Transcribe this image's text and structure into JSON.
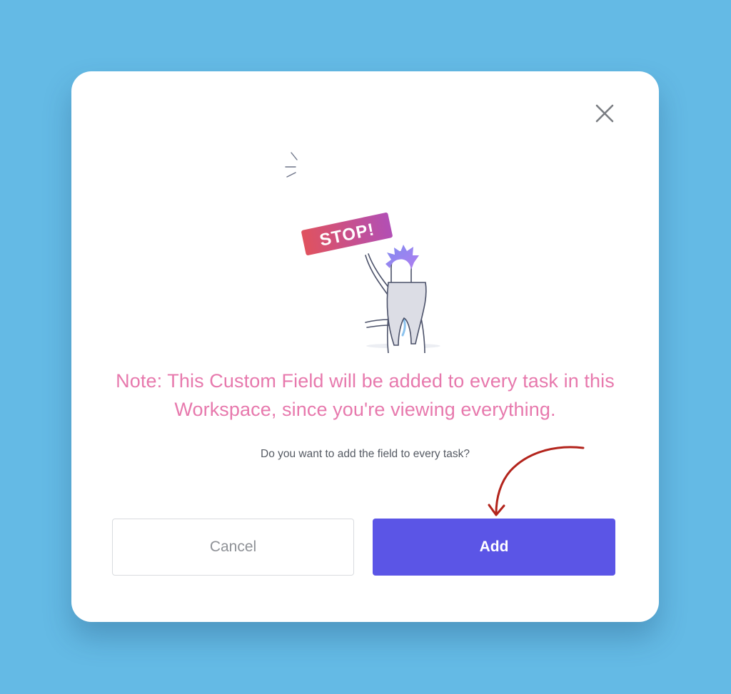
{
  "dialog": {
    "sign_text": "STOP!",
    "note": "Note: This Custom Field will be added to every task in this Workspace, since you're viewing everything.",
    "question": "Do you want to add the field to every task?",
    "buttons": {
      "cancel_label": "Cancel",
      "add_label": "Add"
    },
    "close_icon": "close-icon"
  },
  "colors": {
    "background": "#64bae5",
    "note_text": "#e779ad",
    "primary_button": "#5b55e6",
    "annotation_arrow": "#b3241c"
  }
}
